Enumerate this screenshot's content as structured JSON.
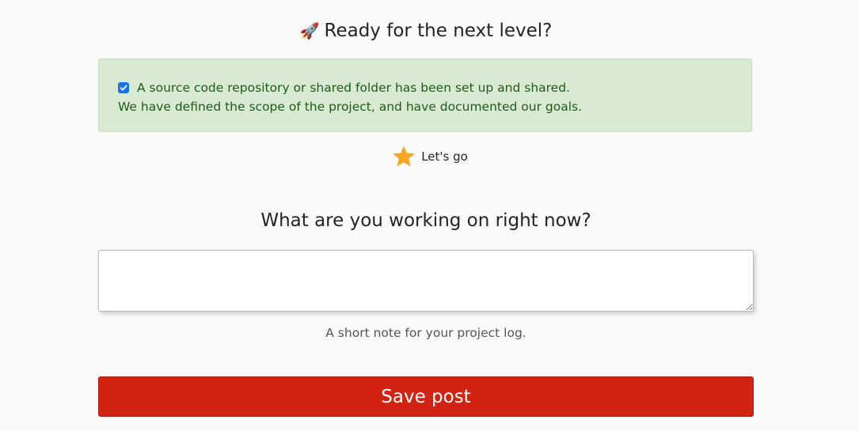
{
  "header": {
    "rocket_glyph": "🚀",
    "title": "Ready for the next level?"
  },
  "checklist": {
    "items": [
      {
        "checked": true,
        "label": "A source code repository or shared folder has been set up and shared."
      },
      {
        "label": "We have defined the scope of the project, and have documented our goals."
      }
    ],
    "colors": {
      "background": "#d9ead3",
      "text": "#1f5a1a",
      "checkbox": "#1a73e8"
    }
  },
  "level": {
    "icon": "star-icon",
    "label": "Let's go",
    "color": "#f5a623"
  },
  "note": {
    "title": "What are you working on right now?",
    "value": "",
    "placeholder": "",
    "help": "A short note for your project log."
  },
  "actions": {
    "save_label": "Save post",
    "save_color": "#d22212"
  }
}
